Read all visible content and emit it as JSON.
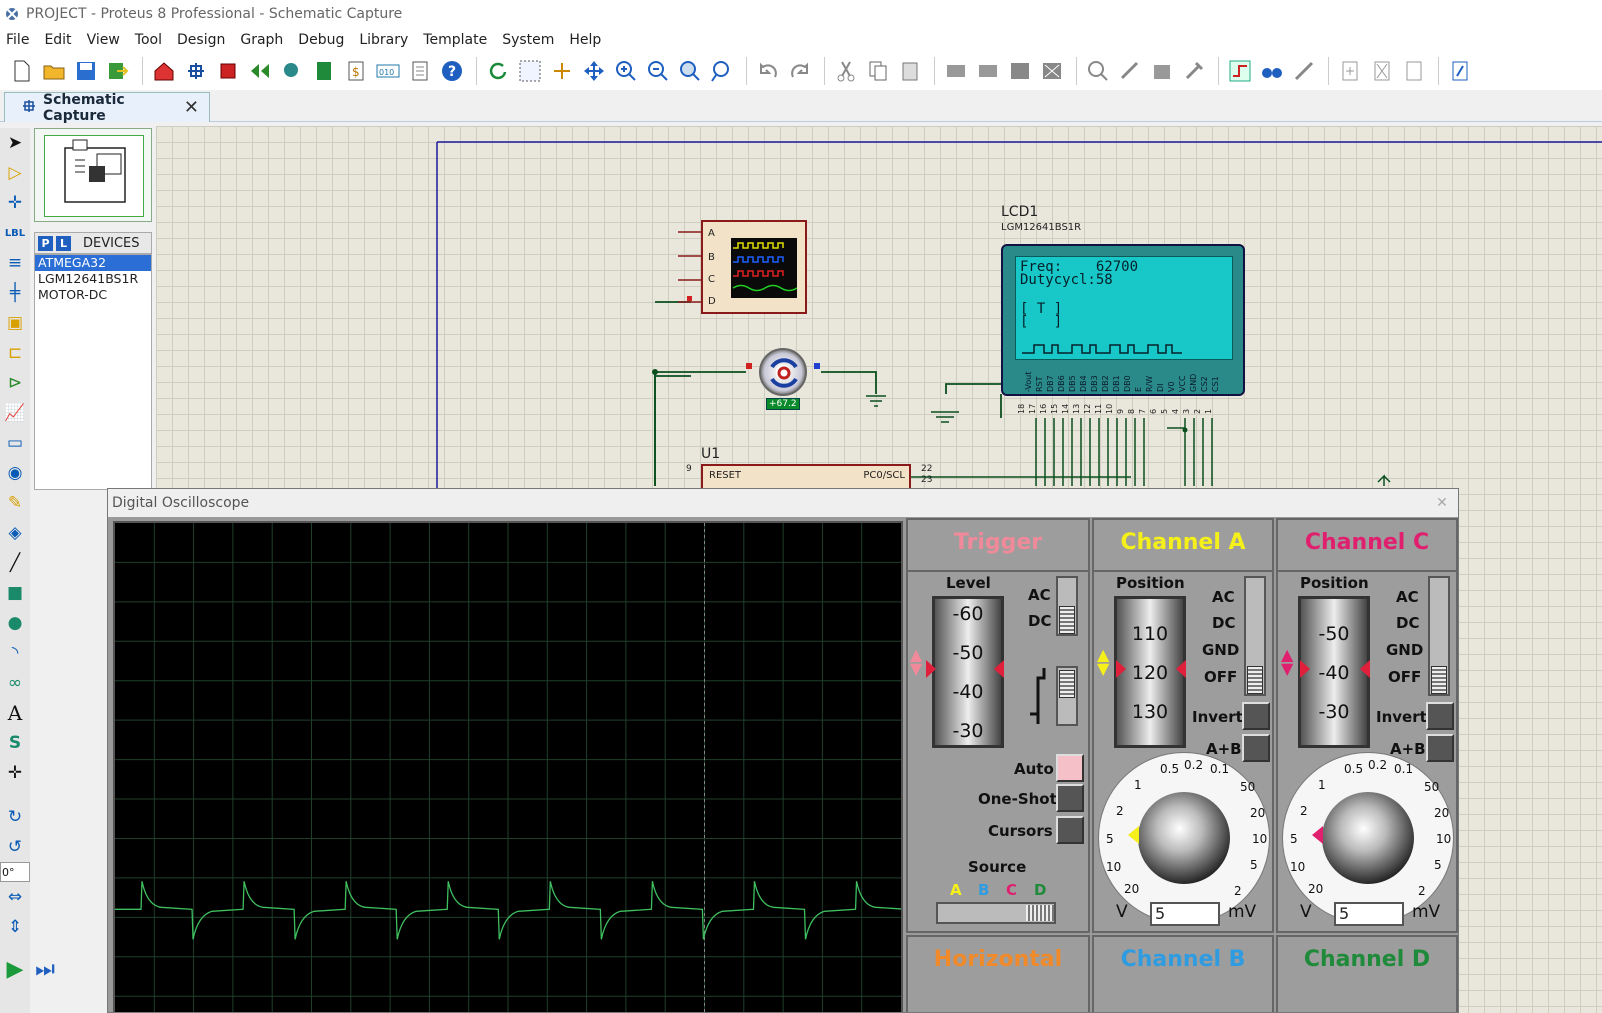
{
  "window": {
    "title": "PROJECT - Proteus 8 Professional - Schematic Capture"
  },
  "menu": [
    "File",
    "Edit",
    "View",
    "Tool",
    "Design",
    "Graph",
    "Debug",
    "Library",
    "Template",
    "System",
    "Help"
  ],
  "tab": {
    "label": "Schematic Capture",
    "close": "✕"
  },
  "devices": {
    "header_p": "P",
    "header_l": "L",
    "header_label": "DEVICES",
    "items": [
      "ATMEGA32",
      "LGM12641BS1R",
      "MOTOR-DC"
    ],
    "selected": "ATMEGA32"
  },
  "left_rotation": "0°",
  "schematic": {
    "lcd_ref": "LCD1",
    "lcd_part": "LGM12641BS1R",
    "lcd_line1": "Freq:    62700",
    "lcd_line2": "Dutycycl:58",
    "lcd_line3": "[ T ]",
    "lcd_line4": "[   ]",
    "lcd_pins": [
      "-Vout",
      "RST",
      "DB7",
      "DB6",
      "DB5",
      "DB4",
      "DB3",
      "DB2",
      "DB1",
      "DB0",
      "E",
      "R/W",
      "DI",
      "V0",
      "VCC",
      "GND",
      "CS2",
      "CS1"
    ],
    "lcd_pin_numbers": [
      "18",
      "17",
      "16",
      "15",
      "14",
      "13",
      "12",
      "11",
      "10",
      "9",
      "8",
      "7",
      "6",
      "5",
      "4",
      "3",
      "2",
      "1"
    ],
    "scope_inputs": [
      "A",
      "B",
      "C",
      "D"
    ],
    "motor_value": "+67.2",
    "u1_ref": "U1",
    "u1_pin_reset": "RESET",
    "u1_pin_reset_num": "9",
    "u1_pin_pc0": "PC0/SCL",
    "u1_pin_pc0_num": "22",
    "u1_pin_next_num": "23"
  },
  "oscilloscope": {
    "title": "Digital Oscilloscope",
    "close": "✕",
    "trigger": {
      "title": "Trigger",
      "level_label": "Level",
      "level_ticks": [
        "-60",
        "-50",
        "-40",
        "-30"
      ],
      "ac": "AC",
      "dc": "DC",
      "auto": "Auto",
      "one_shot": "One-Shot",
      "cursors": "Cursors",
      "source_label": "Source",
      "sources": [
        "A",
        "B",
        "C",
        "D"
      ]
    },
    "channel_a": {
      "title": "Channel A",
      "position_label": "Position",
      "ticks": [
        "110",
        "120",
        "130"
      ],
      "coupling": [
        "AC",
        "DC",
        "GND",
        "OFF"
      ],
      "invert": "Invert",
      "a_plus_b": "A+B",
      "dial_labels": [
        "0.5",
        "0.2",
        "0.1",
        "50",
        "20",
        "10",
        "5",
        "2",
        "1",
        "2",
        "5",
        "10",
        "20"
      ],
      "unit_v": "V",
      "unit_mv": "mV",
      "value": "5"
    },
    "channel_c": {
      "title": "Channel C",
      "position_label": "Position",
      "ticks": [
        "-50",
        "-40",
        "-30"
      ],
      "coupling": [
        "AC",
        "DC",
        "GND",
        "OFF"
      ],
      "invert": "Invert",
      "a_plus_b": "A+B",
      "dial_labels": [
        "0.5",
        "0.2",
        "0.1",
        "50",
        "20",
        "10",
        "5",
        "2",
        "1",
        "2",
        "5",
        "10",
        "20"
      ],
      "unit_v": "V",
      "unit_mv": "mV",
      "value": "5"
    },
    "horizontal": {
      "title": "Horizontal"
    },
    "channel_b": {
      "title": "Channel B"
    },
    "channel_d": {
      "title": "Channel D"
    },
    "colors": {
      "trigger": "#f08a9a",
      "channel_a": "#f5ef1a",
      "channel_b": "#2f9be0",
      "channel_c": "#e0206f",
      "channel_d": "#1f8a3a",
      "horizontal": "#f08a2a",
      "trace": "#3fbf5f"
    }
  }
}
